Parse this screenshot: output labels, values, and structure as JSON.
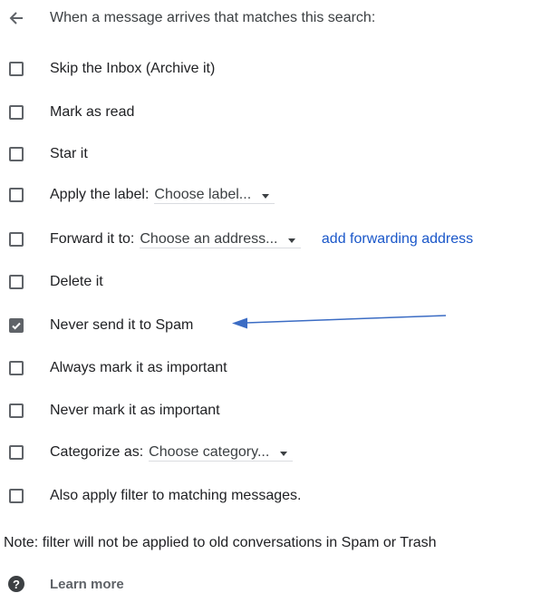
{
  "header": {
    "back_icon": "arrow-left-icon",
    "title": "When a message arrives that matches this search:"
  },
  "options": {
    "skip_inbox": {
      "label": "Skip the Inbox (Archive it)",
      "checked": false
    },
    "mark_read": {
      "label": "Mark as read",
      "checked": false
    },
    "star": {
      "label": "Star it",
      "checked": false
    },
    "apply_label": {
      "label": "Apply the label:",
      "checked": false,
      "select": "Choose label..."
    },
    "forward": {
      "label": "Forward it to:",
      "checked": false,
      "select": "Choose an address...",
      "link": "add forwarding address"
    },
    "delete": {
      "label": "Delete it",
      "checked": false
    },
    "never_spam": {
      "label": "Never send it to Spam",
      "checked": true
    },
    "always_important": {
      "label": "Always mark it as important",
      "checked": false
    },
    "never_important": {
      "label": "Never mark it as important",
      "checked": false
    },
    "categorize": {
      "label": "Categorize as:",
      "checked": false,
      "select": "Choose category..."
    },
    "apply_matching": {
      "label": "Also apply filter to matching messages.",
      "checked": false
    }
  },
  "note": "Note: filter will not be applied to old conversations in Spam or Trash",
  "learn_more": {
    "icon": "help-icon",
    "label": "Learn more"
  },
  "colors": {
    "link": "#1a57c9",
    "annotation_arrow": "#3b6cc4",
    "checkbox": "#5f6368"
  }
}
